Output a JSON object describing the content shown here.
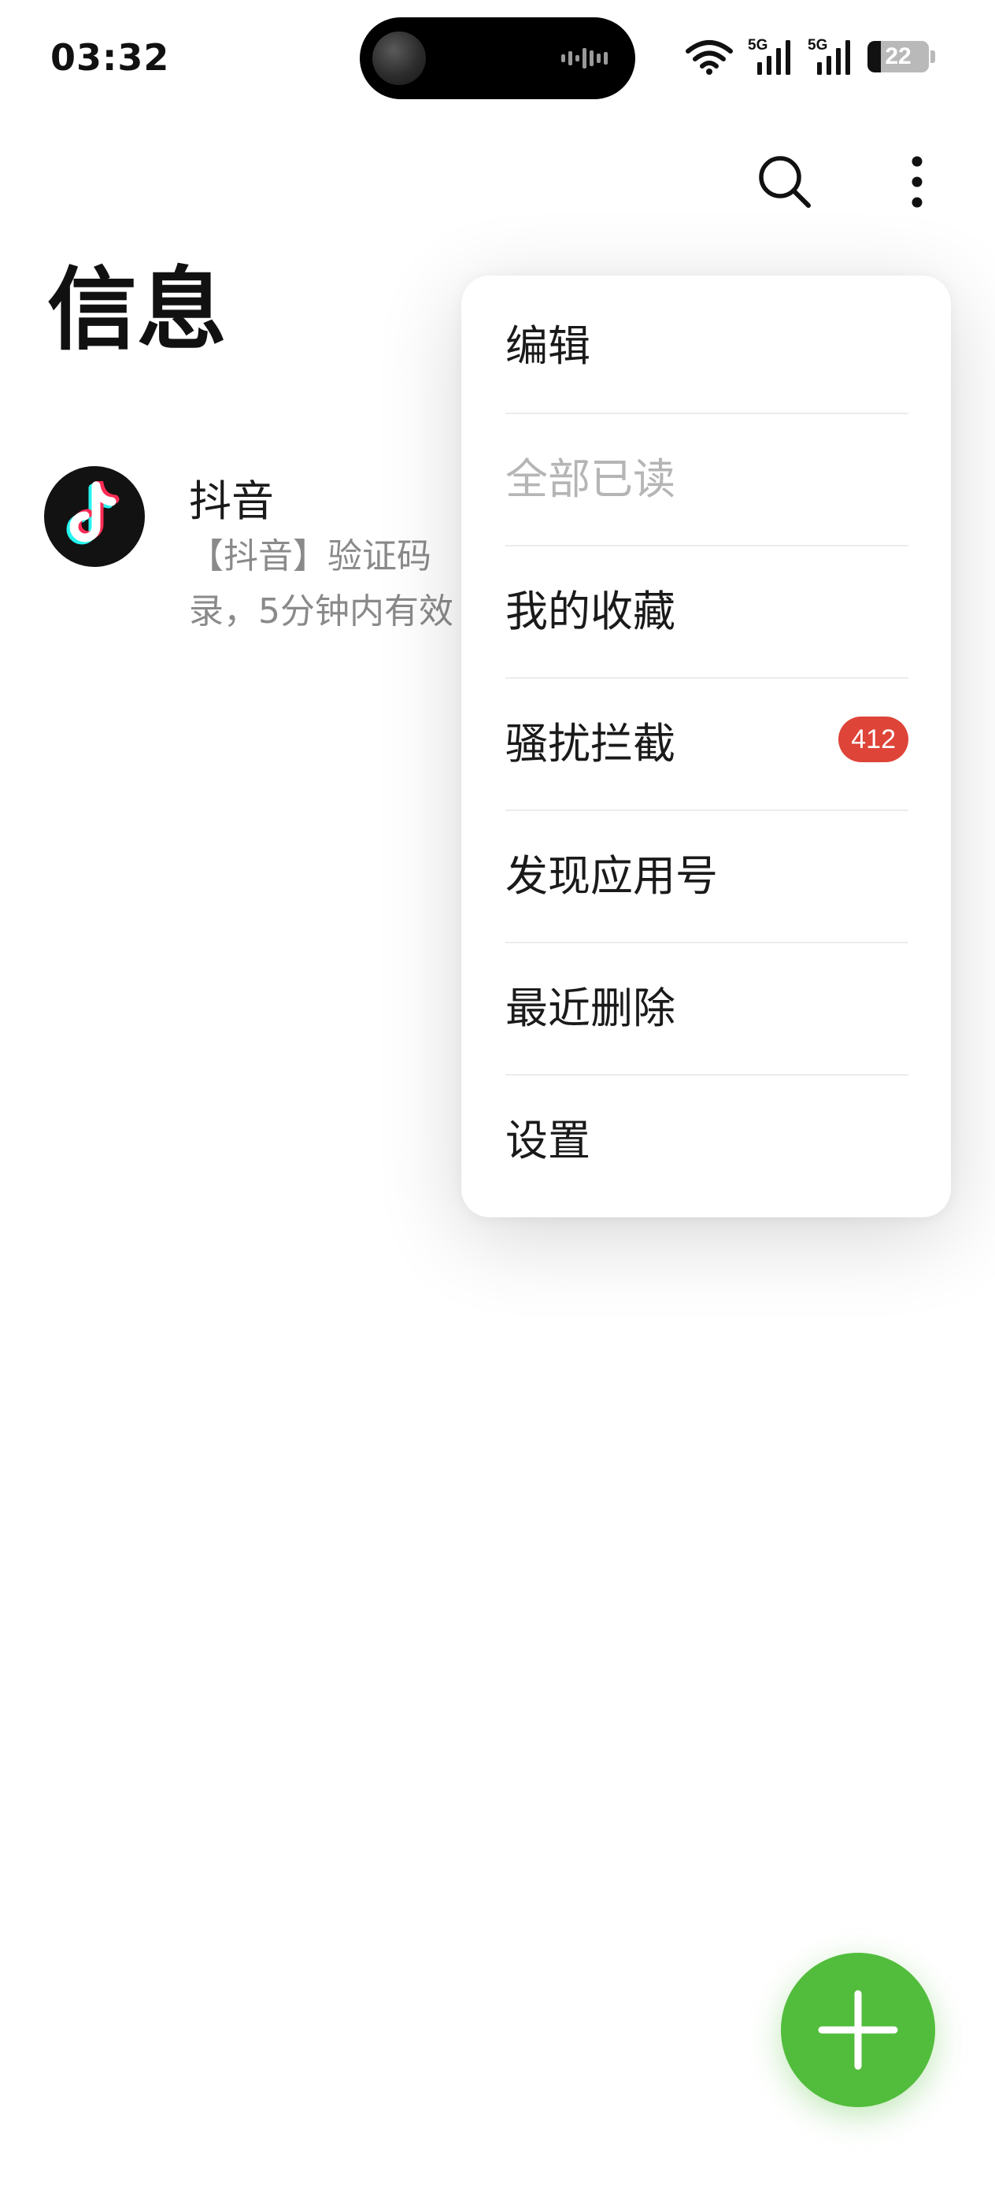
{
  "status_bar": {
    "time": "03:32",
    "network_label_1": "5G",
    "network_label_2": "5G",
    "battery_level": "22",
    "battery_fraction": 0.22
  },
  "header": {
    "title": "信息",
    "search_icon": "search-icon",
    "more_icon": "more-vertical-icon"
  },
  "conversations": [
    {
      "name": "抖音",
      "preview": "【抖音】验证码",
      "preview_line2": "录，5分钟内有效",
      "avatar_icon": "douyin-logo-icon"
    }
  ],
  "menu": {
    "items": [
      {
        "label": "编辑",
        "enabled": true
      },
      {
        "label": "全部已读",
        "enabled": false
      },
      {
        "label": "我的收藏",
        "enabled": true
      },
      {
        "label": "骚扰拦截",
        "enabled": true,
        "badge": "412"
      },
      {
        "label": "发现应用号",
        "enabled": true
      },
      {
        "label": "最近删除",
        "enabled": true
      },
      {
        "label": "设置",
        "enabled": true
      }
    ]
  },
  "fab": {
    "icon": "plus-icon",
    "color": "#52bd3c"
  },
  "colors": {
    "badge": "#de4438",
    "accent": "#52bd3c",
    "disabled_text": "#b5b5b5"
  }
}
